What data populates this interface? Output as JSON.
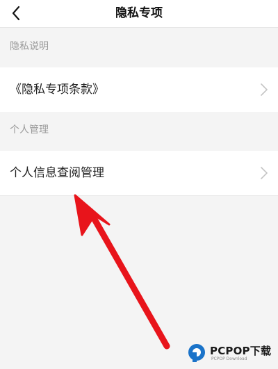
{
  "header": {
    "title": "隐私专项",
    "back_icon": "chevron-left-icon"
  },
  "sections": [
    {
      "header": "隐私说明",
      "rows": [
        {
          "label": "《隐私专项条款》",
          "icon": "chevron-right-icon"
        }
      ]
    },
    {
      "header": "个人管理",
      "rows": [
        {
          "label": "个人信息查阅管理",
          "icon": "chevron-right-icon"
        }
      ]
    }
  ],
  "annotation": {
    "type": "arrow",
    "color": "#e8141b"
  },
  "watermark": {
    "brand": "PCPOP下载",
    "sub": "PCPOP Download",
    "color": "#1a73c9"
  },
  "colors": {
    "background": "#f4f4f4",
    "surface": "#ffffff",
    "section_text": "#9a9a9a",
    "chevron": "#c4c4c4"
  }
}
